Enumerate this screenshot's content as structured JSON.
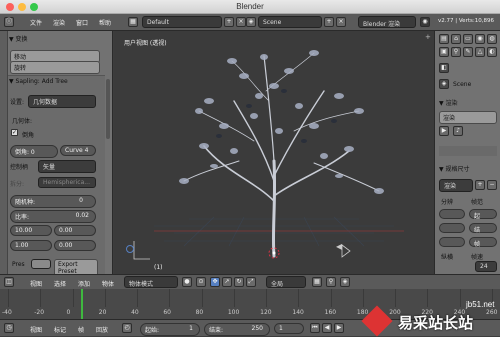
{
  "window": {
    "title": "Blender"
  },
  "menubar": {
    "items": [
      "文件",
      "渲染",
      "窗口",
      "帮助"
    ],
    "layout": "Default",
    "scene": "Scene",
    "engine": "Blender 渲染",
    "version": "v2.77 | Verts:10,896"
  },
  "toolshelf": {
    "transform_header": "▼ 变换",
    "move_button": "移动",
    "rotate_button": "旋转",
    "operator_header": "▼ Sapling: Add Tree",
    "settings_label": "设置:",
    "settings_value": "几何数据",
    "geometry_label": "几何体:",
    "bevel_checkbox_label": "倒角",
    "bevel_field": "倒角: 0",
    "curve_field": "Curve 4",
    "shape_label": "控制柄",
    "shape_value": "矢量",
    "split_label": "拆分:",
    "split_value": "Hemispherica...",
    "seed_field": "随机种:",
    "seed_value": "0",
    "ratio_label": "比率:",
    "ratio_value": "0.02",
    "scale_field": "10.00",
    "scale_var_field": "0.00",
    "scale2_field": "1.00",
    "scale2_var_field": "0.00",
    "pres_label": "Pres",
    "export_button": "Export Preset"
  },
  "viewport": {
    "title": "用户视图 (透视)",
    "frame_label": "(1)"
  },
  "properties": {
    "scene_label": "Scene",
    "render_header": "▼ 渲染",
    "render_button": "渲染",
    "dimensions_header": "▼ 规格尺寸",
    "render_preset": "渲染",
    "resolution_label": "分辨",
    "frame_range_label": "帧范",
    "start_label": "起",
    "end_label": "结",
    "pixel_label": "帧",
    "aspect_label": "纵横",
    "fps_label": "帧速",
    "fps_value": "24"
  },
  "view_header": {
    "items": [
      "视图",
      "选择",
      "添加",
      "物体"
    ],
    "mode": "物体模式",
    "pivot": "全局"
  },
  "timeline": {
    "ticks": [
      "-40",
      "-20",
      "0",
      "20",
      "40",
      "60",
      "80",
      "100",
      "120",
      "140",
      "160",
      "180",
      "200",
      "220",
      "240",
      "260"
    ],
    "current_frame_fraction": 0.15
  },
  "timeline_bar": {
    "items": [
      "视图",
      "标记",
      "帧",
      "回放"
    ],
    "start_label": "起始:",
    "start_value": "1",
    "end_label": "结束:",
    "end_value": "250",
    "current_value": "1"
  },
  "watermark": {
    "url": "jb51.net",
    "brand": "易采站长站"
  },
  "colors": {
    "accent_blue": "#5680c2",
    "timeline_green": "#3fb83f",
    "close": "#fc605b",
    "minimize": "#fdbc40",
    "maximize": "#34c84a"
  }
}
